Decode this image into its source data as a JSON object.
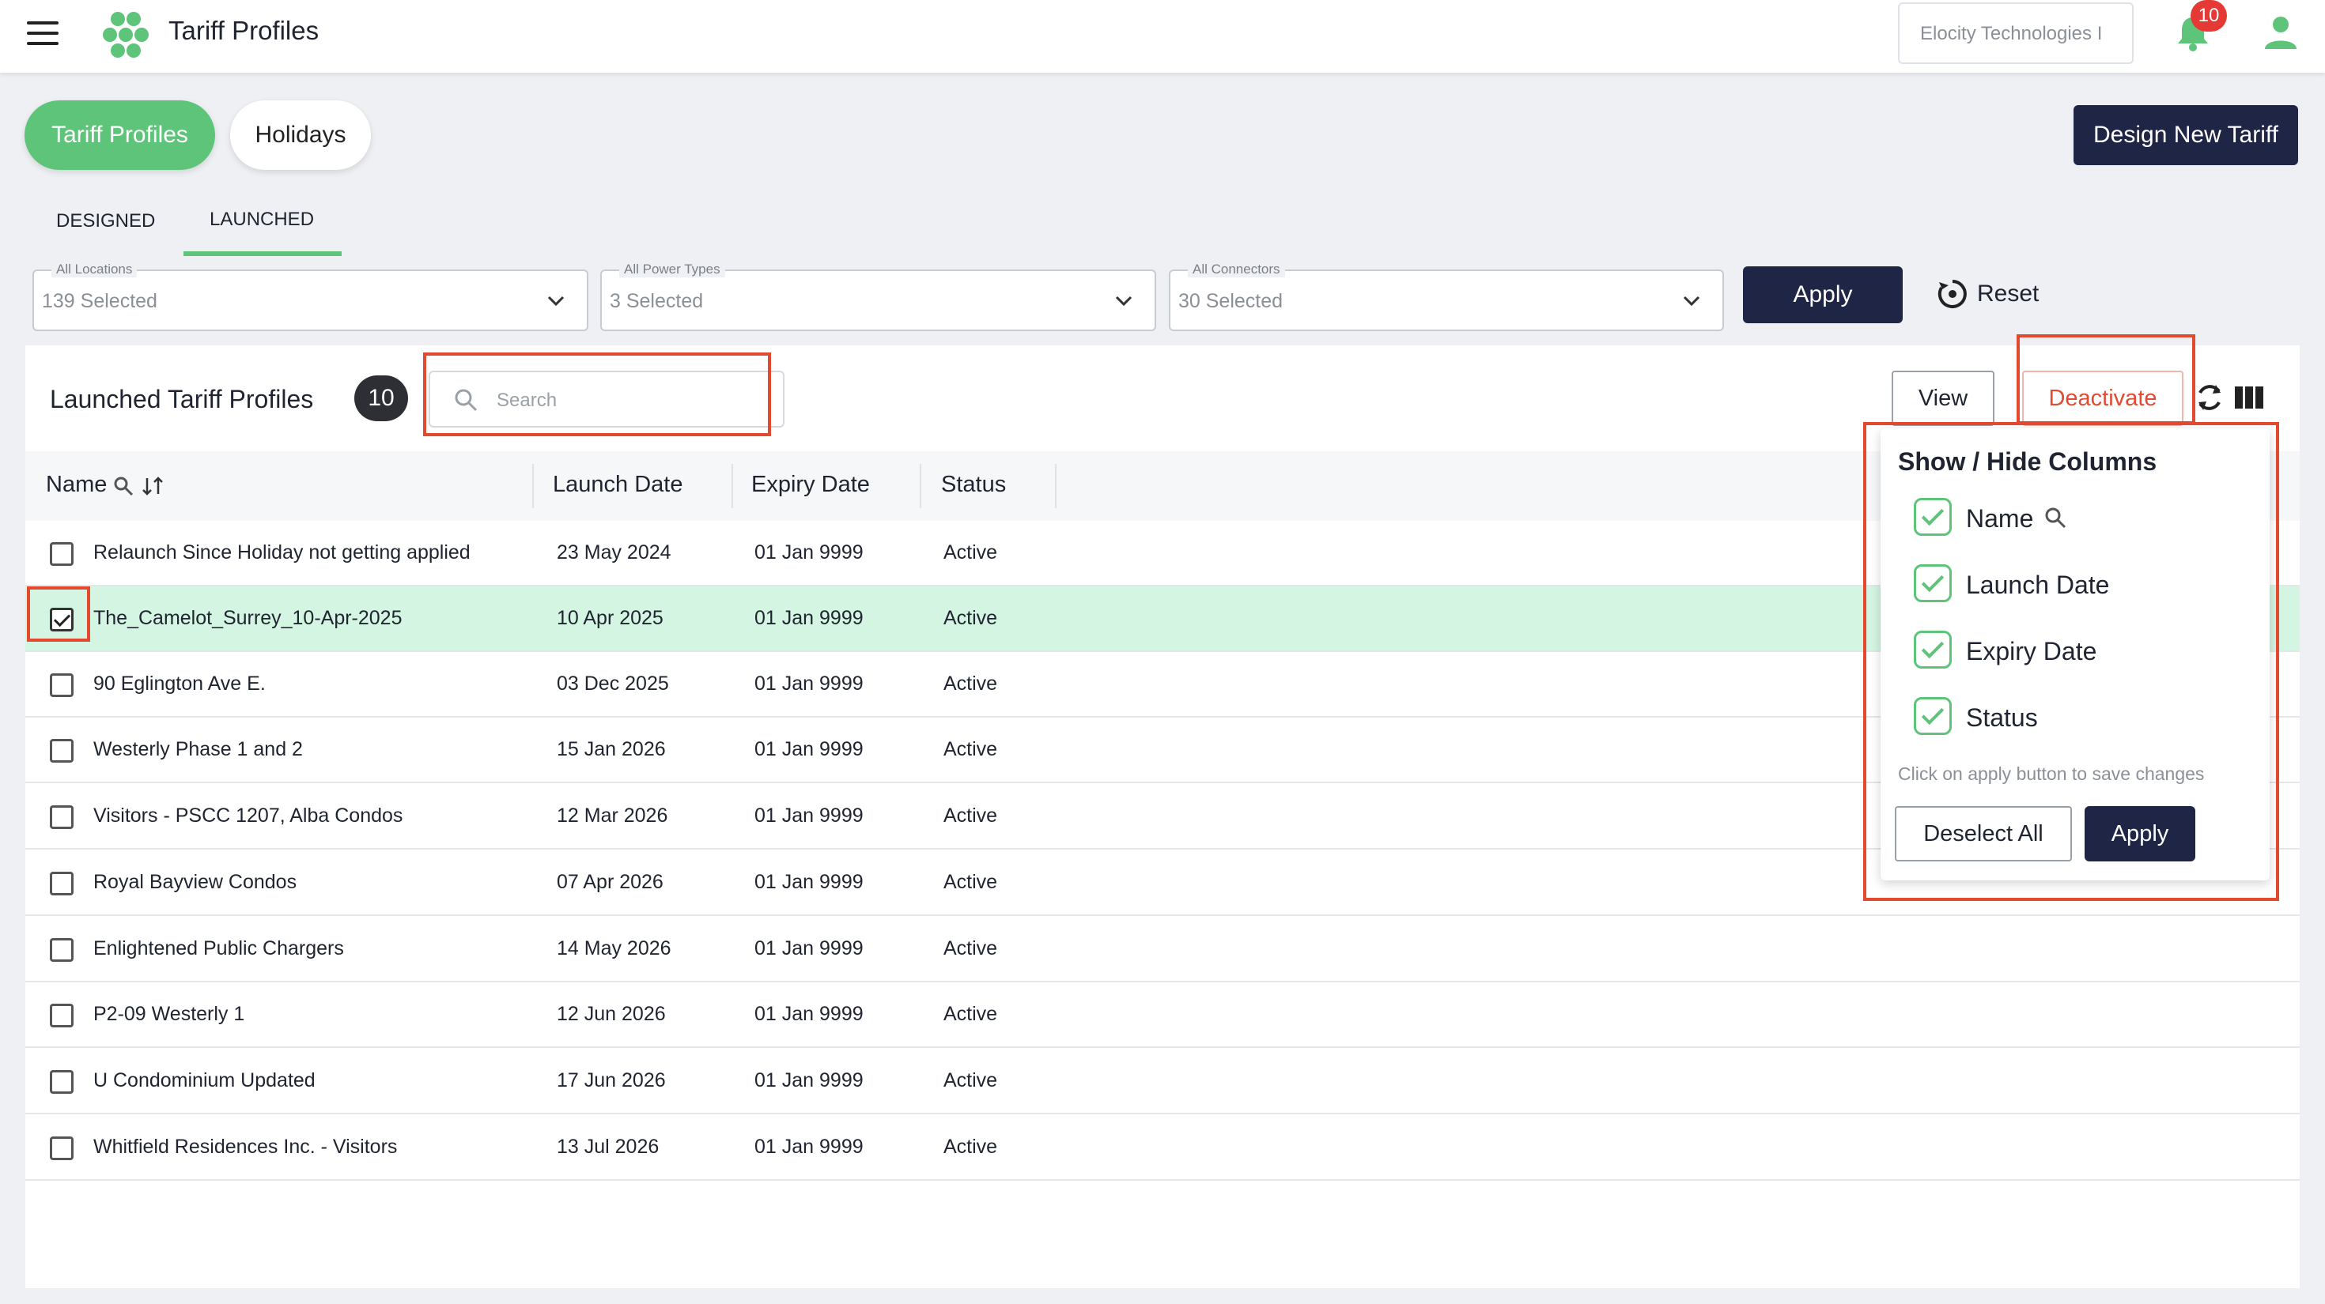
{
  "header": {
    "title": "Tariff Profiles",
    "organization": "Elocity Technologies I",
    "notification_count": "10"
  },
  "top_tabs": [
    {
      "label": "Tariff Profiles",
      "active": true
    },
    {
      "label": "Holidays",
      "active": false
    }
  ],
  "design_button": "Design New Tariff",
  "sub_tabs": [
    {
      "label": "DESIGNED",
      "active": false
    },
    {
      "label": "LAUNCHED",
      "active": true
    }
  ],
  "filters": [
    {
      "label": "All Locations",
      "value": "139 Selected"
    },
    {
      "label": "All Power Types",
      "value": "3 Selected"
    },
    {
      "label": "All Connectors",
      "value": "30 Selected"
    }
  ],
  "filter_apply": "Apply",
  "filter_reset": "Reset",
  "panel": {
    "title": "Launched Tariff Profiles",
    "count": "10",
    "search_placeholder": "Search",
    "view_label": "View",
    "deactivate_label": "Deactivate"
  },
  "table": {
    "columns": [
      "Name",
      "Launch Date",
      "Expiry Date",
      "Status"
    ],
    "rows": [
      {
        "name": "Relaunch Since Holiday not getting applied",
        "launch": "23 May 2024",
        "expiry": "01 Jan 9999",
        "status": "Active",
        "checked": false
      },
      {
        "name": "The_Camelot_Surrey_10-Apr-2025",
        "launch": "10 Apr 2025",
        "expiry": "01 Jan 9999",
        "status": "Active",
        "checked": true
      },
      {
        "name": "90 Eglington Ave E.",
        "launch": "03 Dec 2025",
        "expiry": "01 Jan 9999",
        "status": "Active",
        "checked": false
      },
      {
        "name": "Westerly Phase 1 and 2",
        "launch": "15 Jan 2026",
        "expiry": "01 Jan 9999",
        "status": "Active",
        "checked": false
      },
      {
        "name": "Visitors - PSCC 1207, Alba Condos",
        "launch": "12 Mar 2026",
        "expiry": "01 Jan 9999",
        "status": "Active",
        "checked": false
      },
      {
        "name": "Royal Bayview Condos",
        "launch": "07 Apr 2026",
        "expiry": "01 Jan 9999",
        "status": "Active",
        "checked": false
      },
      {
        "name": "Enlightened Public Chargers",
        "launch": "14 May 2026",
        "expiry": "01 Jan 9999",
        "status": "Active",
        "checked": false
      },
      {
        "name": "P2-09 Westerly 1",
        "launch": "12 Jun 2026",
        "expiry": "01 Jan 9999",
        "status": "Active",
        "checked": false
      },
      {
        "name": "U Condominium Updated",
        "launch": "17 Jun 2026",
        "expiry": "01 Jan 9999",
        "status": "Active",
        "checked": false
      },
      {
        "name": "Whitfield Residences Inc. - Visitors",
        "launch": "13 Jul 2026",
        "expiry": "01 Jan 9999",
        "status": "Active",
        "checked": false
      }
    ]
  },
  "column_popover": {
    "title": "Show / Hide Columns",
    "items": [
      {
        "label": "Name",
        "checked": true
      },
      {
        "label": "Launch Date",
        "checked": true
      },
      {
        "label": "Expiry Date",
        "checked": true
      },
      {
        "label": "Status",
        "checked": true
      }
    ],
    "note": "Click on apply button to save changes",
    "deselect_label": "Deselect All",
    "apply_label": "Apply"
  },
  "colors": {
    "accent_green": "#5dc47a",
    "navy": "#1f2544",
    "danger": "#e24a32",
    "selected_row": "#d3f5e1"
  }
}
